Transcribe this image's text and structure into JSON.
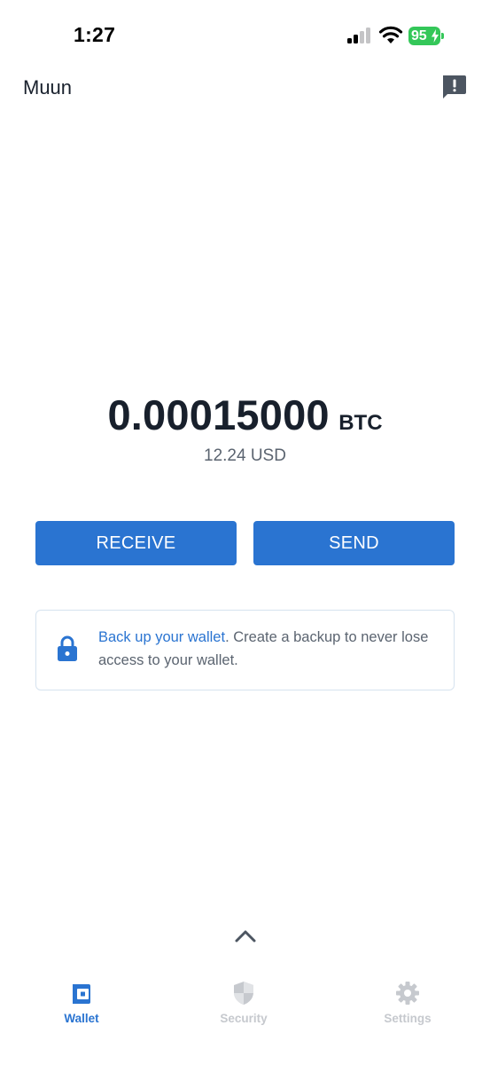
{
  "status_bar": {
    "time": "1:27",
    "battery": "95",
    "battery_color": "#34c759",
    "icons": [
      "signal-icon",
      "wifi-icon",
      "battery-icon"
    ]
  },
  "header": {
    "title": "Muun",
    "feedback_icon": "message-alert-icon"
  },
  "balance": {
    "amount": "0.00015000",
    "unit": "BTC",
    "fiat": "12.24 USD"
  },
  "actions": {
    "receive_label": "RECEIVE",
    "send_label": "SEND",
    "accent_color": "#2a74d1"
  },
  "backup_card": {
    "icon": "lock-icon",
    "link_text": "Back up your wallet",
    "body_text": ". Create a backup to never lose access to your wallet."
  },
  "bottom": {
    "expand_icon": "chevron-up-icon",
    "tabs": [
      {
        "label": "Wallet",
        "icon": "wallet-icon",
        "active": true
      },
      {
        "label": "Security",
        "icon": "shield-icon",
        "active": false
      },
      {
        "label": "Settings",
        "icon": "gear-icon",
        "active": false
      }
    ]
  }
}
